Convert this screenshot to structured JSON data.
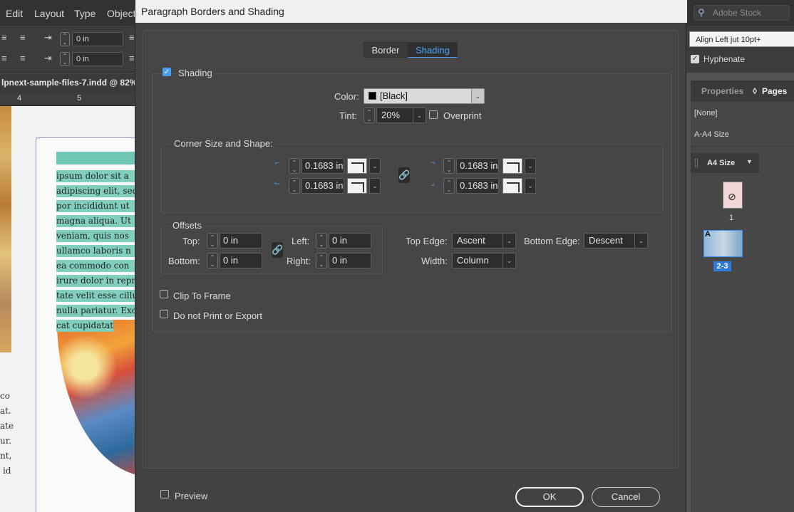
{
  "app": {
    "menu": [
      "Edit",
      "Layout",
      "Type",
      "Object"
    ],
    "control_values": [
      "0 in",
      "0 in"
    ],
    "doc_tab": "lpnext-sample-files-7.indd @ 82%",
    "ruler_numbers": [
      "4",
      "5"
    ],
    "canvas_text": [
      "ipsum dolor sit a",
      "adipiscing elit, sed",
      "por incididunt ut",
      "magna aliqua. Ut",
      "veniam, quis nos",
      "ullamco laboris n",
      "ea commodo con",
      "irure dolor in repre",
      "tate velit esse cillu",
      "nulla pariatur. Exc",
      "cat cupidatat"
    ],
    "left_fragments": [
      "co",
      "at.",
      "ate",
      "ur.",
      "nt,",
      "id"
    ]
  },
  "right": {
    "search_placeholder": "Adobe Stock",
    "paragraph_style": "Align Left jut 10pt+",
    "hyphenate_label": "Hyphenate",
    "tabs": {
      "properties": "Properties",
      "pages": "Pages"
    },
    "master_none": "[None]",
    "master_a4": "A-A4 Size",
    "pages_header": "A4 Size",
    "page1_label": "1",
    "spread_label": "2-3",
    "spread_prefix": "A"
  },
  "dialog": {
    "title": "Paragraph Borders and Shading",
    "tabs": {
      "border": "Border",
      "shading": "Shading"
    },
    "shading_label": "Shading",
    "color_label": "Color:",
    "color_value": "[Black]",
    "tint_label": "Tint:",
    "tint_value": "20%",
    "overprint_label": "Overprint",
    "corner_group_label": "Corner Size and Shape:",
    "corners": {
      "top_left": "0.1683 in",
      "bottom_left": "0.1683 in",
      "top_right": "0.1683 in",
      "bottom_right": "0.1683 in"
    },
    "offsets_label": "Offsets",
    "top_label": "Top:",
    "top_value": "0 in",
    "bottom_label": "Bottom:",
    "bottom_value": "0 in",
    "left_label": "Left:",
    "left_value": "0 in",
    "right_label": "Right:",
    "right_value": "0 in",
    "top_edge_label": "Top Edge:",
    "top_edge_value": "Ascent",
    "bottom_edge_label": "Bottom Edge:",
    "bottom_edge_value": "Descent",
    "width_label": "Width:",
    "width_value": "Column",
    "clip_label": "Clip To Frame",
    "noprint_label": "Do not Print or Export",
    "preview_label": "Preview",
    "ok_label": "OK",
    "cancel_label": "Cancel"
  },
  "colors": {
    "accent": "#4a9ff0",
    "highlight": "#7fcfbc",
    "dialog_bg": "#424242"
  }
}
